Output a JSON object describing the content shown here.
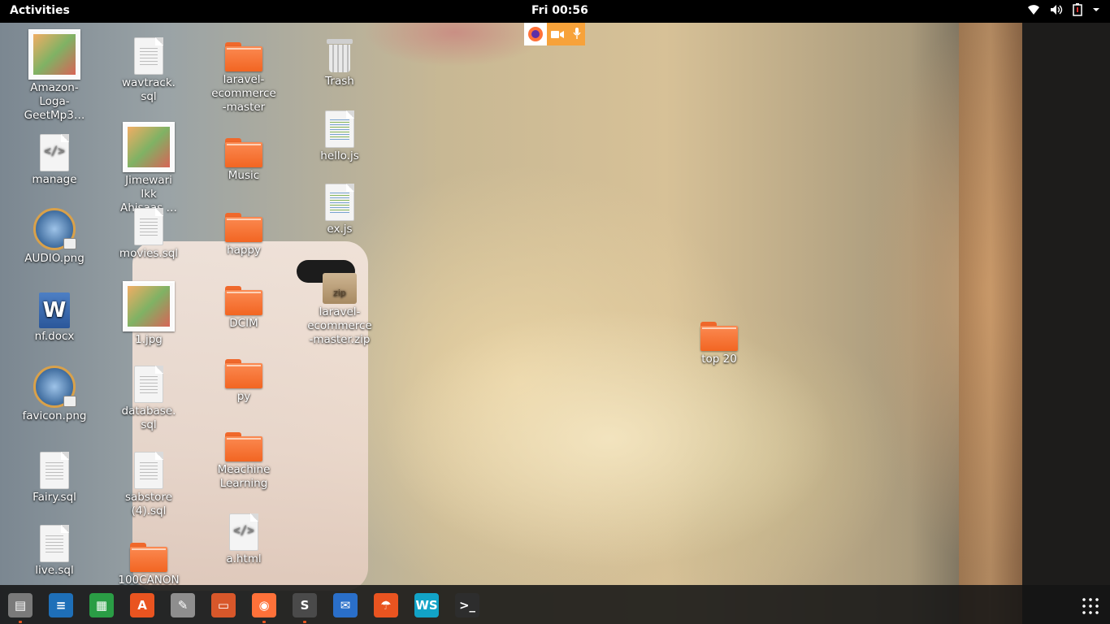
{
  "topbar": {
    "activities": "Activities",
    "clock": "Fri 00:56"
  },
  "colors": {
    "accent": "#e95420",
    "folder": "#f26522",
    "recording_indicator": "#f7a23a"
  },
  "desktop_icons": {
    "c1": [
      {
        "label": "Amazon-\nLoga-\nGeetMp3…",
        "type": "image-thumbnail",
        "icon": "amazon-image-icon"
      },
      {
        "label": "manage",
        "type": "html",
        "icon": "code-file-icon"
      },
      {
        "label": "AUDIO.png",
        "type": "image",
        "icon": "png-image-icon"
      },
      {
        "label": "nf.docx",
        "type": "docx",
        "icon": "word-document-icon"
      },
      {
        "label": "favicon.png",
        "type": "image",
        "icon": "png-image-icon"
      },
      {
        "label": "Fairy.sql",
        "type": "sql",
        "icon": "text-file-icon"
      },
      {
        "label": "live.sql",
        "type": "sql",
        "icon": "text-file-icon"
      }
    ],
    "c2": [
      {
        "label": "wavtrack.\nsql",
        "type": "sql",
        "icon": "text-file-icon"
      },
      {
        "label": "Jimewari\nIkk\nAhisaas …",
        "type": "image-thumbnail",
        "icon": "image-thumbnail-icon"
      },
      {
        "label": "movies.sql",
        "type": "sql",
        "icon": "text-file-icon"
      },
      {
        "label": "1.jpg",
        "type": "image-thumbnail",
        "icon": "jpg-image-icon"
      },
      {
        "label": "database.\nsql",
        "type": "sql",
        "icon": "text-file-icon"
      },
      {
        "label": "sabstore\n(4).sql",
        "type": "sql",
        "icon": "text-file-icon"
      },
      {
        "label": "100CANON",
        "type": "folder",
        "icon": "folder-icon"
      }
    ],
    "c3": [
      {
        "label": "laravel-\necommerce\n-master",
        "type": "folder",
        "icon": "folder-icon"
      },
      {
        "label": "Music",
        "type": "folder",
        "icon": "folder-icon"
      },
      {
        "label": "happy",
        "type": "folder",
        "icon": "folder-icon"
      },
      {
        "label": "DCIM",
        "type": "folder",
        "icon": "folder-icon"
      },
      {
        "label": "py",
        "type": "folder",
        "icon": "folder-icon"
      },
      {
        "label": "Meachine\nLearning",
        "type": "folder",
        "icon": "folder-icon"
      },
      {
        "label": "a.html",
        "type": "html",
        "icon": "code-file-icon"
      }
    ],
    "c4": [
      {
        "label": "Trash",
        "type": "trash",
        "icon": "trash-icon"
      },
      {
        "label": "hello.js",
        "type": "js",
        "icon": "javascript-file-icon"
      },
      {
        "label": "ex.js",
        "type": "js",
        "icon": "javascript-file-icon"
      },
      {
        "label": "laravel-\necommerce\n-master.zip",
        "type": "zip",
        "icon": "zip-archive-icon",
        "badge": "zip"
      }
    ],
    "loose": [
      {
        "label": "top 20",
        "type": "folder",
        "icon": "folder-icon"
      }
    ]
  },
  "dock": {
    "items": [
      {
        "name": "files-icon",
        "color": "#7a7a7a",
        "glyph": "▤",
        "running": true
      },
      {
        "name": "libreoffice-writer-icon",
        "color": "#1e6fb8",
        "glyph": "≡",
        "running": false
      },
      {
        "name": "libreoffice-calc-icon",
        "color": "#2a9d45",
        "glyph": "▦",
        "running": false
      },
      {
        "name": "ubuntu-software-icon",
        "color": "#e95420",
        "glyph": "A",
        "running": false
      },
      {
        "name": "system-tools-icon",
        "color": "#8e8e8e",
        "glyph": "✎",
        "running": false
      },
      {
        "name": "libreoffice-impress-icon",
        "color": "#d8572a",
        "glyph": "▭",
        "running": false
      },
      {
        "name": "firefox-icon",
        "color": "#ff7139",
        "glyph": "◉",
        "running": true
      },
      {
        "name": "sublime-text-icon",
        "color": "#4a4a4a",
        "glyph": "S",
        "running": true
      },
      {
        "name": "thunderbird-icon",
        "color": "#2a6fc9",
        "glyph": "✉",
        "running": false
      },
      {
        "name": "umbrella-app-icon",
        "color": "#e95420",
        "glyph": "☂",
        "running": false
      },
      {
        "name": "webstorm-icon",
        "color": "#12a3c7",
        "glyph": "WS",
        "running": false
      },
      {
        "name": "terminal-icon",
        "color": "#2d2d2d",
        "glyph": ">_",
        "running": false
      }
    ]
  }
}
